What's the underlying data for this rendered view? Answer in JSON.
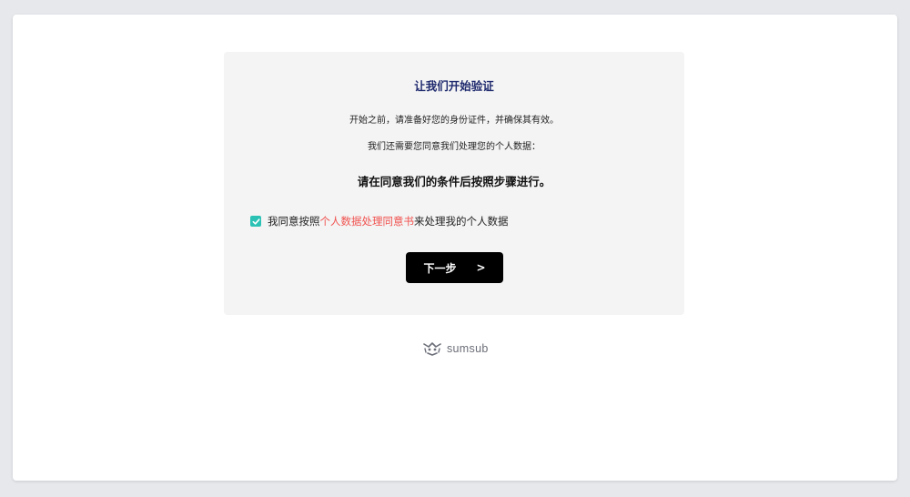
{
  "card": {
    "title": "让我们开始验证",
    "intro": "开始之前，请准备好您的身份证件，并确保其有效。",
    "consent_request": "我们还需要您同意我们处理您的个人数据：",
    "instruction": "请在同意我们的条件后按照步骤进行。"
  },
  "consent": {
    "checked": true,
    "prefix": "我同意按照",
    "link_text": "个人数据处理同意书",
    "suffix": "来处理我的个人数据"
  },
  "next_button": {
    "label": "下一步",
    "chevron": ">"
  },
  "brand": {
    "name": "sumsub",
    "icon": "sumsub-logo-icon"
  },
  "colors": {
    "title": "#1f2a6e",
    "checkbox": "#2bc2b5",
    "link": "#f0524f",
    "button": "#000000",
    "card_bg": "#f4f4f4"
  }
}
